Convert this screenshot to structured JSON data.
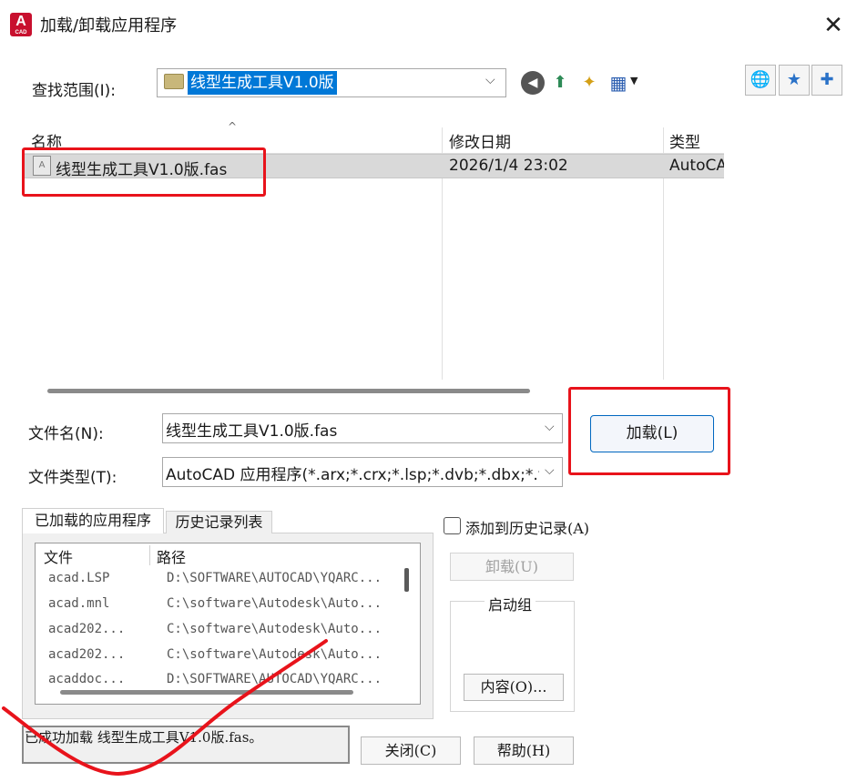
{
  "window": {
    "title": "加载/卸载应用程序",
    "logo_letter": "A",
    "logo_sub": "CAD",
    "close_glyph": "✕"
  },
  "lookin": {
    "label": "查找范围(I):",
    "value": "线型生成工具V1.0版",
    "chevron": "⌵"
  },
  "toolbar": {
    "back": "◀",
    "up": "⬆",
    "new_folder": "✦",
    "views": "▦",
    "views_arrow": "▼",
    "web": "🌐",
    "favorites": "★",
    "add_favorite": "✚"
  },
  "filelist": {
    "columns": {
      "name": "名称",
      "date": "修改日期",
      "type": "类型"
    },
    "sort_arrow": "^",
    "rows": [
      {
        "name": "线型生成工具V1.0版.fas",
        "date": "2026/1/4 23:02",
        "type": "AutoCAD"
      }
    ]
  },
  "filename": {
    "label": "文件名(N):",
    "value": "线型生成工具V1.0版.fas",
    "chevron": "⌵"
  },
  "filetype": {
    "label": "文件类型(T):",
    "value": "AutoCAD 应用程序(*.arx;*.crx;*.lsp;*.dvb;*.dbx;*.v",
    "chevron": "⌵"
  },
  "load_button": "加载(L)",
  "tabs": {
    "loaded": "已加载的应用程序",
    "history": "历史记录列表"
  },
  "apps": {
    "header_file": "文件",
    "header_path": "路径",
    "rows": [
      {
        "file": "acad.LSP",
        "path": "D:\\SOFTWARE\\AUTOCAD\\YQARC..."
      },
      {
        "file": "acad.mnl",
        "path": "C:\\software\\Autodesk\\Auto..."
      },
      {
        "file": "acad202...",
        "path": "C:\\software\\Autodesk\\Auto..."
      },
      {
        "file": "acad202...",
        "path": "C:\\software\\Autodesk\\Auto..."
      },
      {
        "file": "acaddoc...",
        "path": "D:\\SOFTWARE\\AUTOCAD\\YQARC..."
      }
    ]
  },
  "history_checkbox": "添加到历史记录(A)",
  "unload_button": "卸载(U)",
  "startup_group": {
    "label": "启动组",
    "contents_button": "内容(O)..."
  },
  "status_text": "已成功加载 线型生成工具V1.0版.fas。",
  "close_button": "关闭(C)",
  "help_button": "帮助(H)",
  "colors": {
    "accent": "#0078d7",
    "annotation_red": "#e8131b",
    "logo_red": "#c8102e"
  }
}
